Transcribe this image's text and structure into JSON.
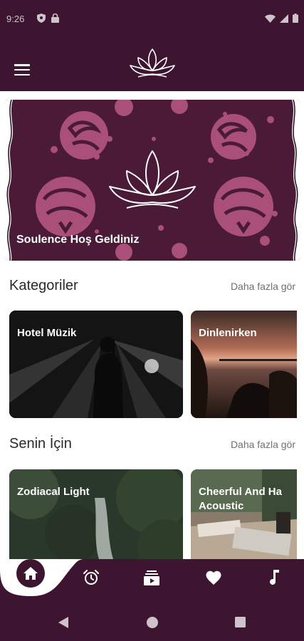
{
  "status_bar": {
    "time": "9:26"
  },
  "hero": {
    "title": "Soulence Hoş Geldiniz"
  },
  "categories": {
    "title": "Kategoriler",
    "more_label": "Daha fazla gör",
    "items": [
      {
        "label": "Hotel Müzik"
      },
      {
        "label": "Dinlenirken"
      }
    ]
  },
  "for_you": {
    "title": "Senin İçin",
    "more_label": "Daha fazla gör",
    "items": [
      {
        "label": "Zodiacal Light"
      },
      {
        "label": "Cheerful And Ha\nAcoustic"
      }
    ]
  },
  "bottom_nav": {
    "items": [
      "home-icon",
      "alarm-clock-icon",
      "playlist-icon",
      "heart-icon",
      "music-note-icon"
    ]
  },
  "colors": {
    "brand": "#3e1530",
    "accent": "#a94f78",
    "text": "#2a2a2a",
    "muted": "#6f6f6f"
  }
}
